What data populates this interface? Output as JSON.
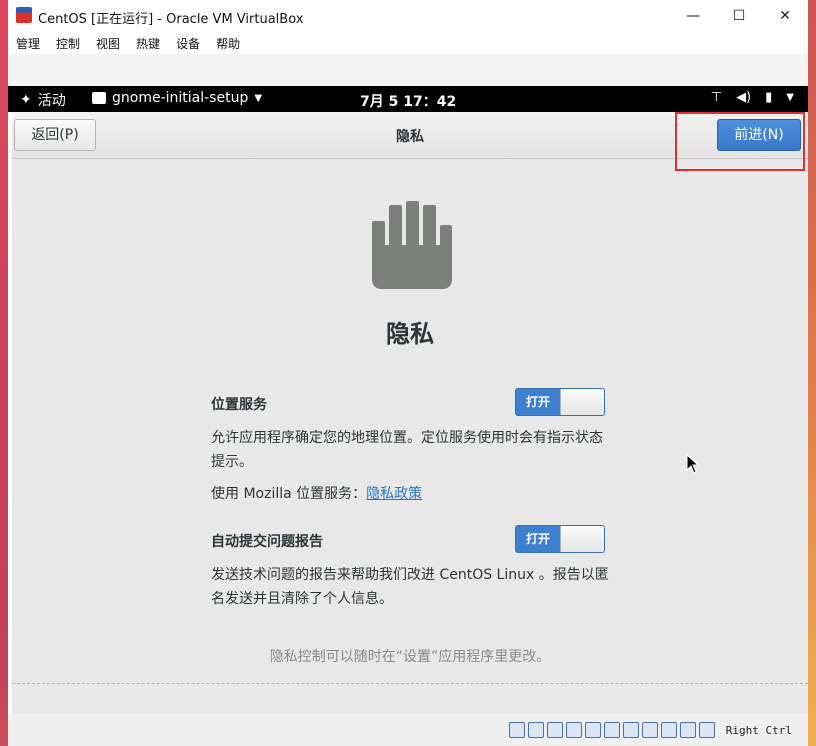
{
  "window": {
    "title": "CentOS [正在运行] - Oracle VM VirtualBox",
    "minimize": "—",
    "maximize": "☐",
    "close": "✕"
  },
  "menu": [
    "管理",
    "控制",
    "视图",
    "热键",
    "设备",
    "帮助"
  ],
  "gnome_topbar": {
    "activities": "活动",
    "app_name": "gnome-initial-setup",
    "clock": "7月 5  17：42"
  },
  "header": {
    "back_label": "返回(P)",
    "title": "隐私",
    "next_label": "前进(N)"
  },
  "page": {
    "title": "隐私",
    "location": {
      "label": "位置服务",
      "switch_text": "打开",
      "description": "允许应用程序确定您的地理位置。定位服务使用时会有指示状态提示。",
      "mozilla_prefix": "使用 Mozilla 位置服务：",
      "policy_link": "隐私政策"
    },
    "problem_report": {
      "label": "自动提交问题报告",
      "switch_text": "打开",
      "description": "发送技术问题的报告来帮助我们改进 CentOS Linux 。报告以匿名发送并且清除了个人信息。"
    },
    "footnote": "隐私控制可以随时在“设置”应用程序里更改。"
  },
  "statusbar": {
    "host_key": "Right Ctrl"
  },
  "colors": {
    "accent": "#3d80cf",
    "link": "#2a76c6",
    "highlight_box": "#e03030"
  }
}
